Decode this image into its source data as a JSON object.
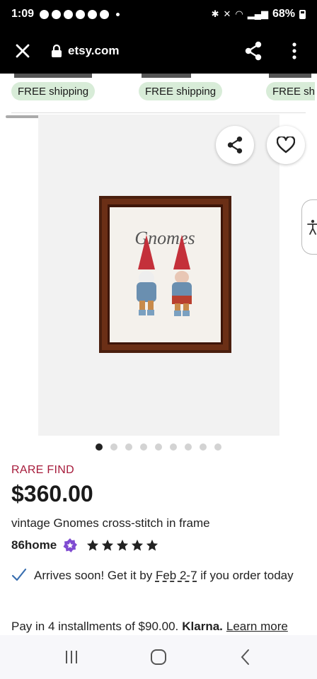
{
  "status_bar": {
    "time": "1:09",
    "battery": "68%",
    "icons": [
      "notification-icon",
      "notification-icon",
      "notification-icon",
      "notification-icon",
      "notification-icon",
      "messenger-icon"
    ]
  },
  "browser": {
    "url": "etsy.com",
    "icons": {
      "close": "close-icon",
      "lock": "lock-icon",
      "share": "share-icon",
      "menu": "more-vert-icon"
    }
  },
  "related": {
    "shipping_labels": [
      "FREE shipping",
      "FREE shipping",
      "FREE sh"
    ]
  },
  "gallery": {
    "image_count": 9,
    "active_index": 0,
    "artwork_caption": "Gnomes"
  },
  "product": {
    "badge": "RARE FIND",
    "price": "$360.00",
    "title": "vintage Gnomes cross-stitch in frame",
    "shop_name": "86home",
    "rating_stars": 5,
    "arrival_lead": "Arrives soon! Get it by ",
    "arrival_date": "Feb 2-7",
    "arrival_tail": " if you order today",
    "installments_text": "Pay in 4 installments of $90.00.",
    "klarna": "Klarna.",
    "learn_more": "Learn more"
  },
  "colors": {
    "badge": "#a61a3a",
    "shipping_pill": "#d8ecd8",
    "check": "#3a6fb0",
    "star_seller": "#7f4bd1"
  }
}
